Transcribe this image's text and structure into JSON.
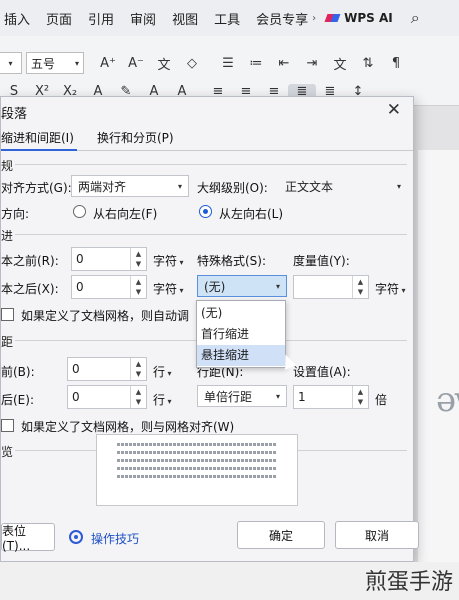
{
  "menubar": {
    "items": [
      "插入",
      "页面",
      "引用",
      "审阅",
      "视图",
      "工具",
      "会员专享"
    ],
    "ai_label": "WPS AI"
  },
  "toolbar": {
    "font_size": "五号",
    "font_color_hex": "#e53935",
    "highlight_color_hex": "#1e6be5"
  },
  "dialog": {
    "title": "段落",
    "tabs": [
      "缩进和间距(I)",
      "换行和分页(P)"
    ],
    "general": {
      "section": "规",
      "alignment_label": "对齐方式(G):",
      "alignment_value": "两端对齐",
      "outline_label": "大纲级别(O):",
      "outline_value": "正文文本",
      "direction_label": "方向:",
      "rtl_label": "从右向左(F)",
      "ltr_label": "从左向右(L)",
      "direction_selected": "ltr"
    },
    "indent": {
      "section": "进",
      "before_label": "本之前(R):",
      "before_value": "0",
      "before_unit": "字符",
      "after_label": "本之后(X):",
      "after_value": "0",
      "after_unit": "字符",
      "special_label": "特殊格式(S):",
      "special_value": "(无)",
      "measure_label": "度量值(Y):",
      "measure_value": "",
      "measure_unit": "字符",
      "grid_checkbox_label": "如果定义了文档网格，则自动调",
      "special_options": [
        "(无)",
        "首行缩进",
        "悬挂缩进"
      ],
      "special_highlighted": "悬挂缩进"
    },
    "spacing": {
      "section": "距",
      "before_label": "前(B):",
      "before_value": "0",
      "before_unit": "行",
      "after_label": "后(E):",
      "after_value": "0",
      "after_unit": "行",
      "line_label": "行距(N):",
      "line_value": "单倍行距",
      "setting_label": "设置值(A):",
      "setting_value": "1",
      "setting_unit": "倍",
      "grid_checkbox_label": "如果定义了文档网格，则与网格对齐(W)"
    },
    "preview": {
      "section": "览"
    },
    "buttons": {
      "tabs": "表位(T)...",
      "tips": "操作技巧",
      "ok": "确定",
      "cancel": "取消"
    }
  },
  "watermark": "煎蛋手游"
}
